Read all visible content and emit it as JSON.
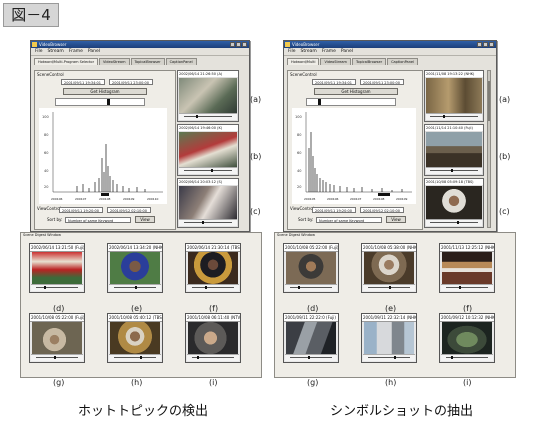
{
  "figure_label": "図－4",
  "left": {
    "window_title": "VideoBrowser",
    "menu": [
      "File",
      "Stream",
      "Frame",
      "Panel"
    ],
    "tabs": [
      "Hotword/Multi-Program Selector",
      "VideoStream",
      "TopicalBrowser",
      "CaptionPanel"
    ],
    "panel_title": "SceneControl",
    "range_start": "2001/09/11 19:34:01",
    "range_end": "2001/09/11 23:00:00",
    "button_histogram": "Get Histogram",
    "axis_ticks": [
      "200106",
      "200107",
      "200108",
      "200109",
      "200110"
    ],
    "view_control_title": "ViewControl",
    "view_start": "2001/09/11 19:20:00",
    "view_end": "2001/09/12 02:10:00",
    "sort_label": "Sort by:",
    "sort_value": "Number of same Keyword",
    "button_view": "View",
    "side_thumbs": [
      {
        "caption": "2002/06/14 21:26:50 (A)",
        "letter": "(a)"
      },
      {
        "caption": "2002/06/14 19:46:00 (K)",
        "letter": "(b)"
      },
      {
        "caption": "2002/06/14 20:03:12 (S)",
        "letter": "(c)"
      }
    ],
    "strip_title": "Scene Digest Window",
    "thumbs": [
      {
        "caption": "2002/06/14 13:21:50 (Fuji)",
        "letter": "(d)"
      },
      {
        "caption": "2002/06/14 13:34:20 (NHK)",
        "letter": "(e)"
      },
      {
        "caption": "2002/06/14 21:30:14 (TBS)",
        "letter": "(f)"
      },
      {
        "caption": "2001/10/08 05:22:00 (Fuji)",
        "letter": "(g)"
      },
      {
        "caption": "2001/10/08 05:40:12 (TBS)",
        "letter": "(h)"
      },
      {
        "caption": "2001/10/08 06:11:40 (NTV)",
        "letter": "(i)"
      }
    ],
    "bottom_caption": "ホットトピックの検出"
  },
  "right": {
    "window_title": "VideoBrowser",
    "menu": [
      "File",
      "Stream",
      "Frame",
      "Panel"
    ],
    "tabs": [
      "Hotword/Multi",
      "VideoStream",
      "TopicalBrowser",
      "CaptionPanel"
    ],
    "panel_title": "SceneControl",
    "range_start": "2001/09/11 19:34:01",
    "range_end": "2001/09/11 23:00:00",
    "button_histogram": "Get Histogram",
    "axis_ticks": [
      "200105",
      "200106",
      "200107",
      "200108",
      "200109"
    ],
    "view_control_title": "ViewControl",
    "view_start": "2001/09/11 19:20:00",
    "view_end": "2001/09/12 02:10:00",
    "sort_label": "Sort by:",
    "sort_value": "Number of same Keyword",
    "button_view": "View",
    "side_thumbs": [
      {
        "caption": "2001/11/08 19:13:22 (NHK)",
        "letter": "(a)"
      },
      {
        "caption": "2001/11/14 21:10:40 (Fuji)",
        "letter": "(b)"
      },
      {
        "caption": "2001/10/08 05:09:18 (TBS)",
        "letter": "(c)"
      }
    ],
    "strip_title": "Scene Digest Window",
    "thumbs": [
      {
        "caption": "2001/10/08 05:22:00 (Fuji)",
        "letter": "(d)"
      },
      {
        "caption": "2001/10/08 05:38:00 (NHK)",
        "letter": "(e)"
      },
      {
        "caption": "2001/11/13 12:25:12 (NHK)",
        "letter": "(f)"
      },
      {
        "caption": "2001/09/11 22:22:0 (Fuji)",
        "letter": "(g)"
      },
      {
        "caption": "2001/09/11 22:32:14 (NHK)",
        "letter": "(h)"
      },
      {
        "caption": "2001/09/12 10:12:32 (NHK)",
        "letter": "(i)"
      }
    ],
    "bottom_caption": "シンボルショットの抽出"
  }
}
